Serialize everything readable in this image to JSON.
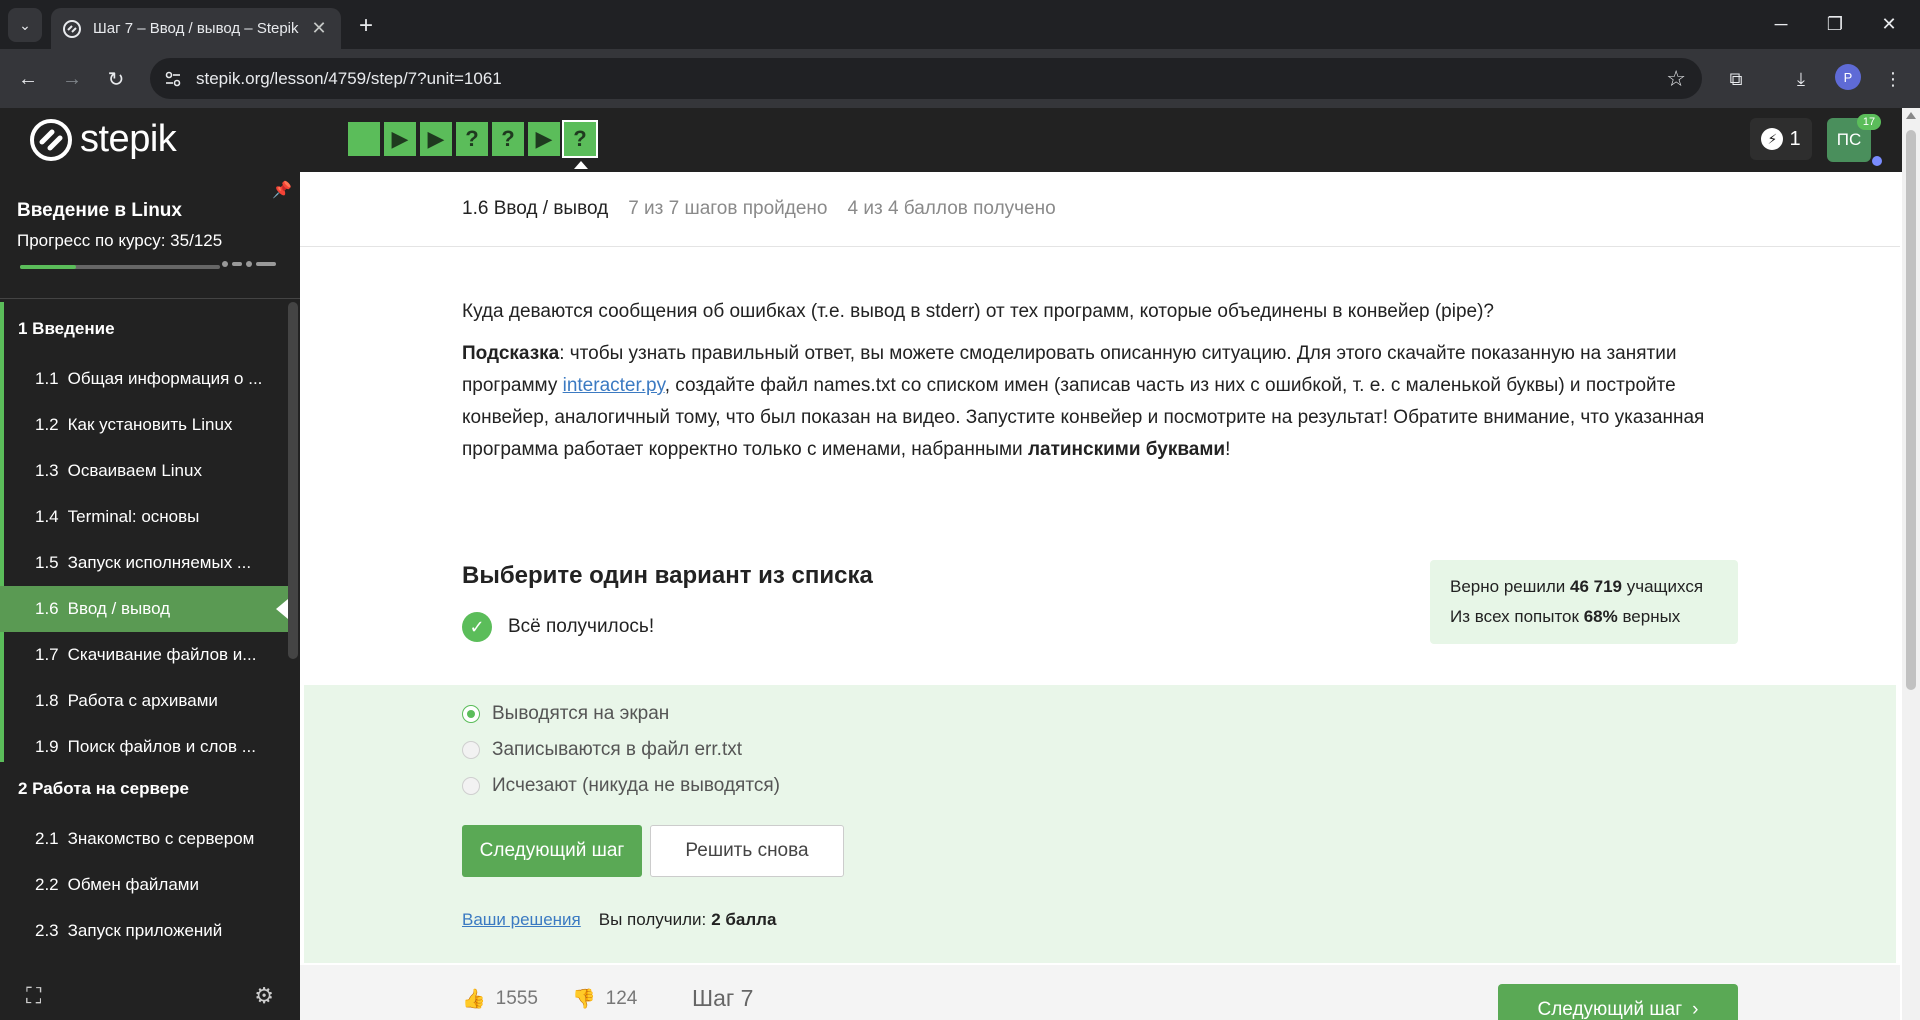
{
  "browser": {
    "tab_title": "Шаг 7 – Ввод / вывод – Stepik",
    "url": "stepik.org/lesson/4759/step/7?unit=1061",
    "profile_initial": "P"
  },
  "header": {
    "logo_text": "stepik",
    "steps": [
      {
        "type": "play",
        "glyph": ""
      },
      {
        "type": "play",
        "glyph": "▶"
      },
      {
        "type": "play",
        "glyph": "▶"
      },
      {
        "type": "quiz",
        "glyph": "?"
      },
      {
        "type": "quiz",
        "glyph": "?"
      },
      {
        "type": "play",
        "glyph": "▶"
      },
      {
        "type": "quiz",
        "glyph": "?"
      }
    ],
    "energy": "1",
    "avatar": "ПС",
    "notifications": "17"
  },
  "sidebar": {
    "course_title": "Введение в Linux",
    "progress_label": "Прогресс по курсу:  35/125",
    "progress_fraction": 0.28,
    "modules": [
      {
        "title": "1  Введение",
        "lessons": [
          {
            "num": "1.1",
            "title": "Общая информация о ..."
          },
          {
            "num": "1.2",
            "title": "Как установить Linux"
          },
          {
            "num": "1.3",
            "title": "Осваиваем Linux"
          },
          {
            "num": "1.4",
            "title": "Terminal: основы"
          },
          {
            "num": "1.5",
            "title": "Запуск исполняемых ..."
          },
          {
            "num": "1.6",
            "title": "Ввод / вывод"
          },
          {
            "num": "1.7",
            "title": "Скачивание файлов и..."
          },
          {
            "num": "1.8",
            "title": "Работа с архивами"
          },
          {
            "num": "1.9",
            "title": "Поиск файлов и слов ..."
          }
        ]
      },
      {
        "title": "2  Работа на сервере",
        "lessons": [
          {
            "num": "2.1",
            "title": "Знакомство с сервером"
          },
          {
            "num": "2.2",
            "title": "Обмен файлами"
          },
          {
            "num": "2.3",
            "title": "Запуск приложений"
          }
        ]
      }
    ]
  },
  "lesson": {
    "name": "1.6 Ввод / вывод",
    "steps_done": "7 из 7 шагов пройдено",
    "points": "4 из 4 баллов  получено"
  },
  "question": {
    "text": "Куда деваются сообщения об ошибках (т.е. вывод в stderr) от тех программ, которые объединены в конвейер (pipe)?",
    "hint_label": "Подсказка",
    "hint_part1": ": чтобы узнать правильный ответ, вы можете смоделировать описанную ситуацию. Для этого скачайте показанную на занятии программу ",
    "hint_link": "interacter.py",
    "hint_part2": ", создайте файл names.txt со списком имен (записав часть из них с ошибкой, т. е. с маленькой буквы) и постройте конвейер, аналогичный тому, что был показан на видео. Запустите конвейер и посмотрите на результат! Обратите внимание, что указанная программа работает корректно только с именами, набранными ",
    "hint_bold": "латинскими буквами",
    "hint_end": "!"
  },
  "quiz": {
    "title": "Выберите один вариант из списка",
    "success": "Всё получилось!",
    "stats_line1_pre": "Верно решили ",
    "stats_line1_num": "46 719",
    "stats_line1_post": " учащихся",
    "stats_line2_pre": "Из всех попыток ",
    "stats_line2_num": "68%",
    "stats_line2_post": " верных",
    "options": [
      {
        "label": "Выводятся на экран",
        "selected": true
      },
      {
        "label": "Записываются в файл err.txt",
        "selected": false
      },
      {
        "label": "Исчезают (никуда не выводятся)",
        "selected": false
      }
    ],
    "next_button": "Следующий шаг",
    "retry_button": "Решить снова",
    "solutions_link": "Ваши решения",
    "score_label": "Вы получили:",
    "score_value": "2 балла"
  },
  "footer": {
    "likes": "1555",
    "dislikes": "124",
    "step_label": "Шаг 7",
    "next_button": "Следующий шаг"
  },
  "colors": {
    "accent": "#5bbd5a",
    "dark": "#222222",
    "link": "#3b7ac2"
  }
}
